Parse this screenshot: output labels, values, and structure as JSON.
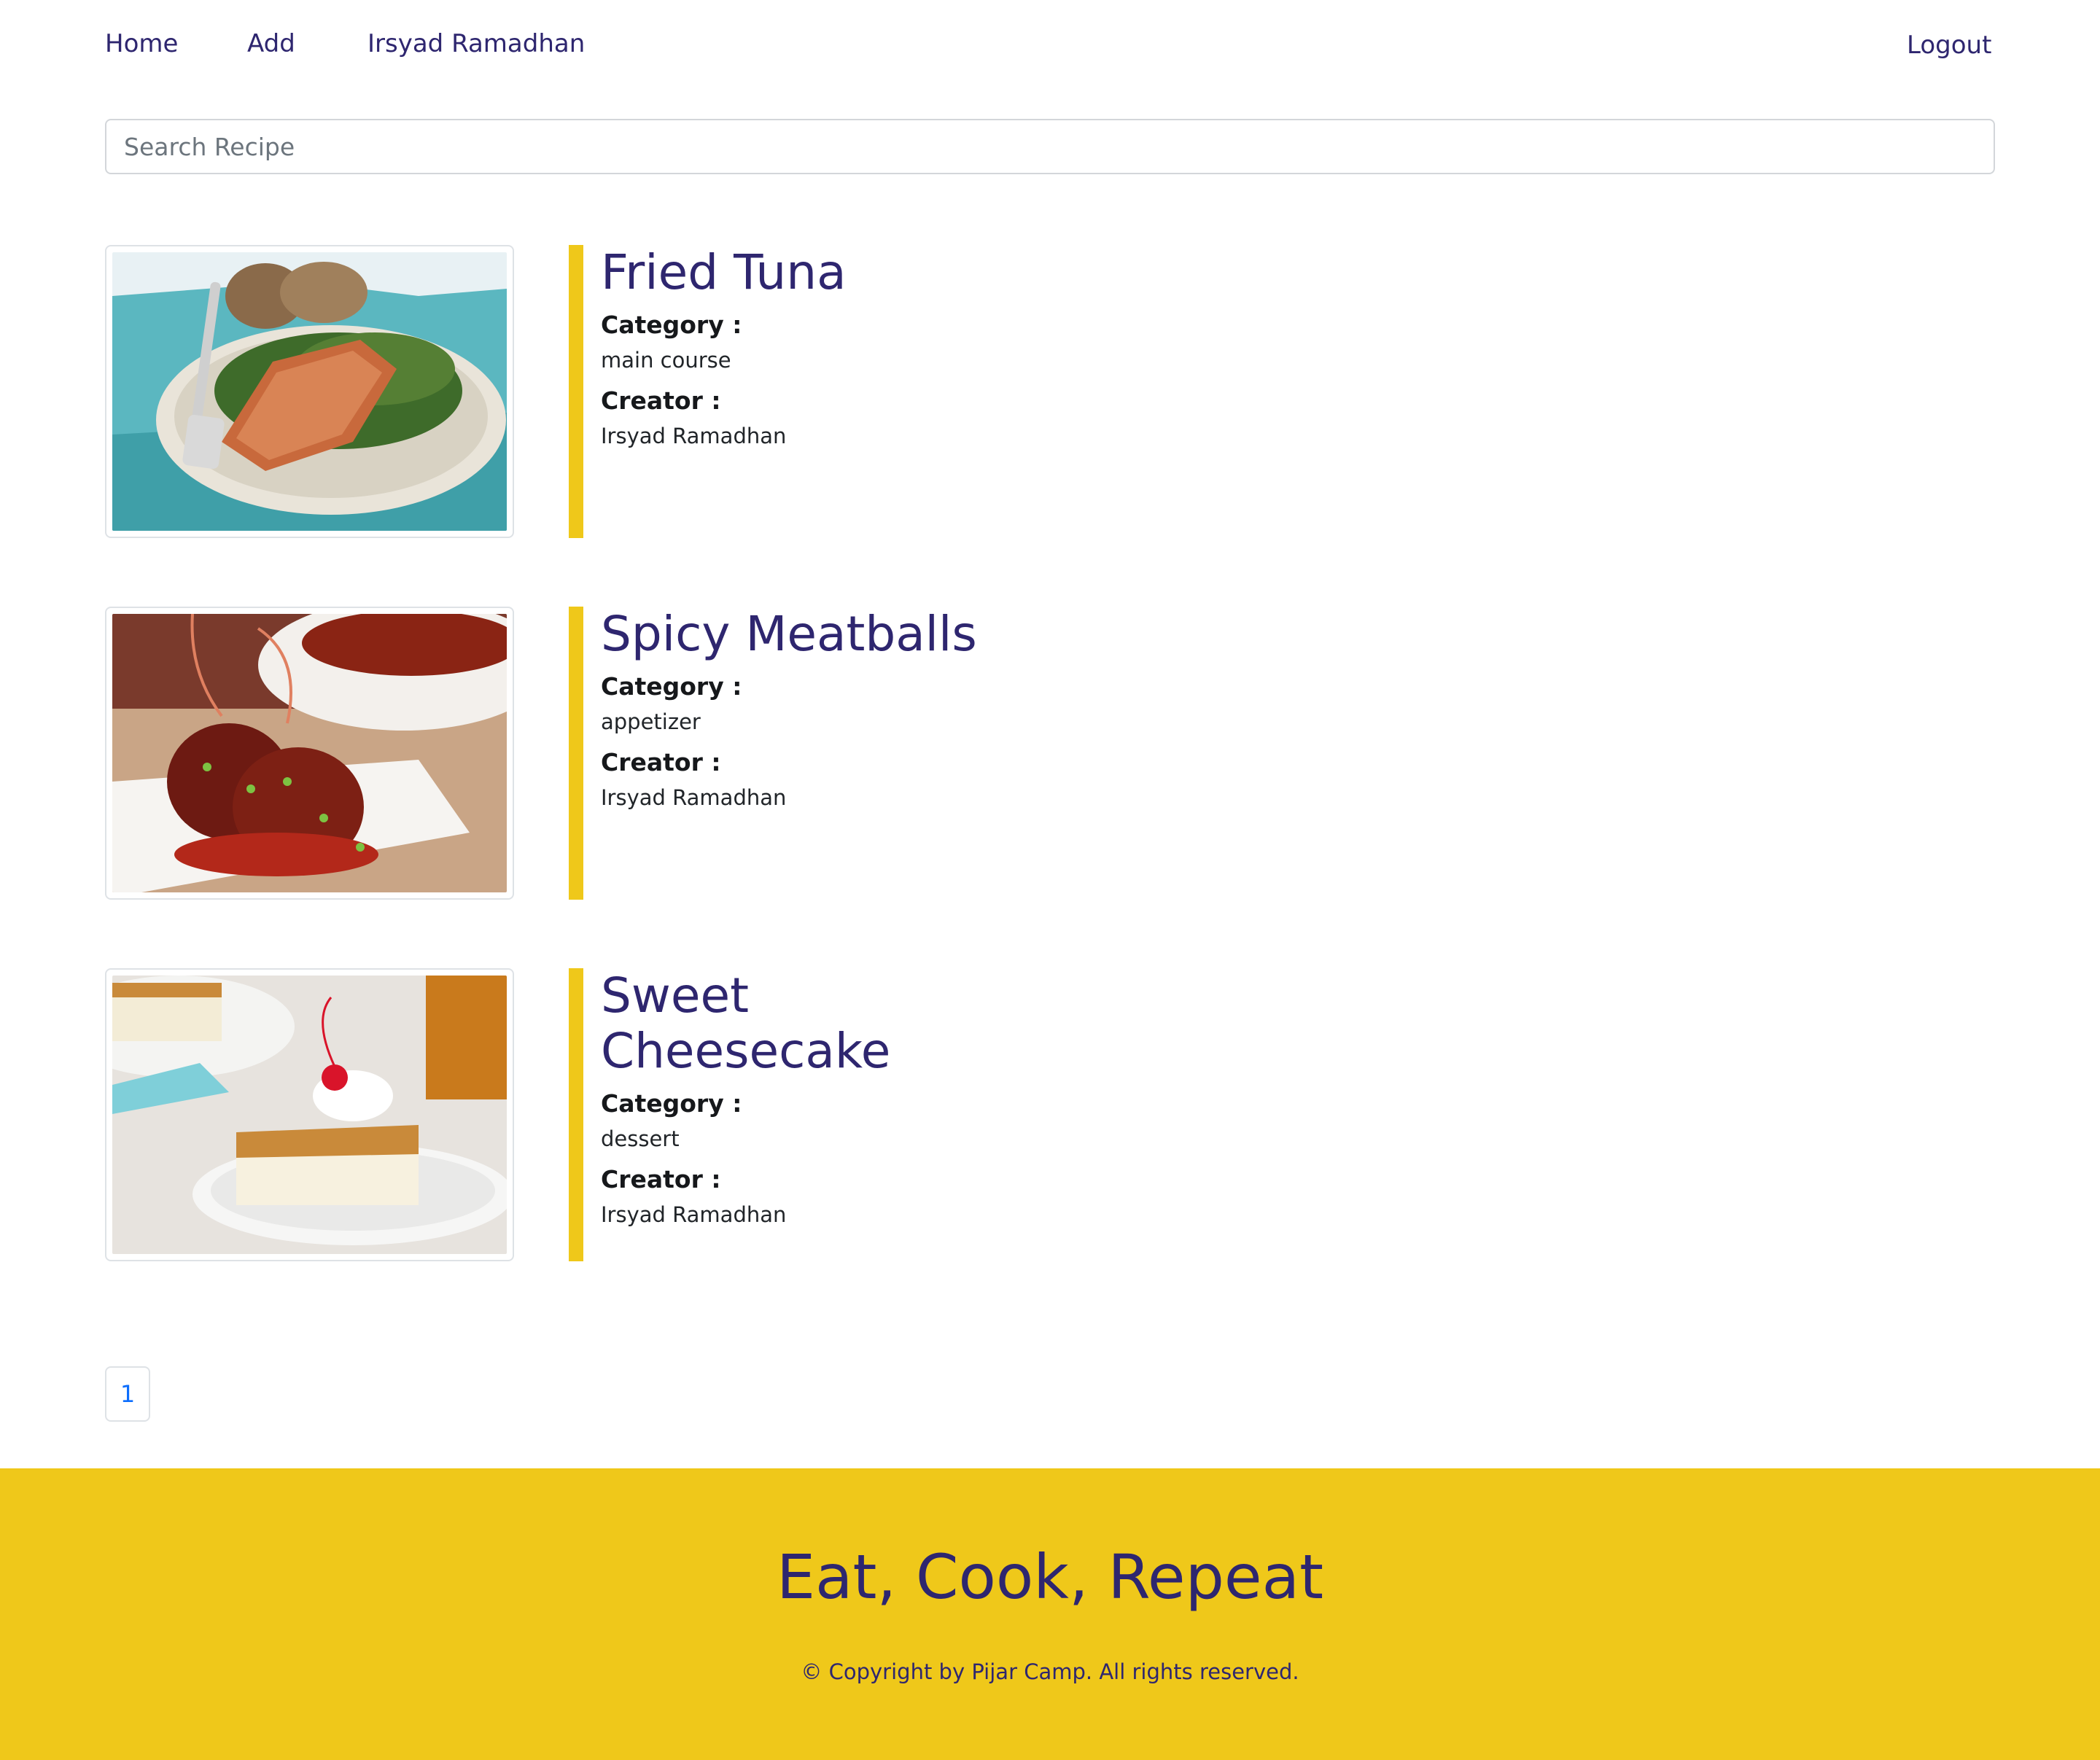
{
  "nav": {
    "home": "Home",
    "add": "Add",
    "user": "Irsyad Ramadhan",
    "logout": "Logout"
  },
  "search": {
    "placeholder": "Search Recipe",
    "value": ""
  },
  "recipes": [
    {
      "title": "Fried Tuna",
      "category_label": "Category :",
      "category": "main course",
      "creator_label": "Creator :",
      "creator": "Irsyad Ramadhan"
    },
    {
      "title": "Spicy Meatballs",
      "category_label": "Category :",
      "category": "appetizer",
      "creator_label": "Creator :",
      "creator": "Irsyad Ramadhan"
    },
    {
      "title": "Sweet Cheesecake",
      "category_label": "Category :",
      "category": "dessert",
      "creator_label": "Creator :",
      "creator": "Irsyad Ramadhan"
    }
  ],
  "pagination": {
    "pages": [
      "1"
    ]
  },
  "footer": {
    "tagline": "Eat, Cook, Repeat",
    "copyright": "© Copyright by Pijar Camp. All rights reserved."
  },
  "colors": {
    "accent": "#efc81a",
    "primary_text": "#2e266f",
    "link": "#0d6efd"
  }
}
